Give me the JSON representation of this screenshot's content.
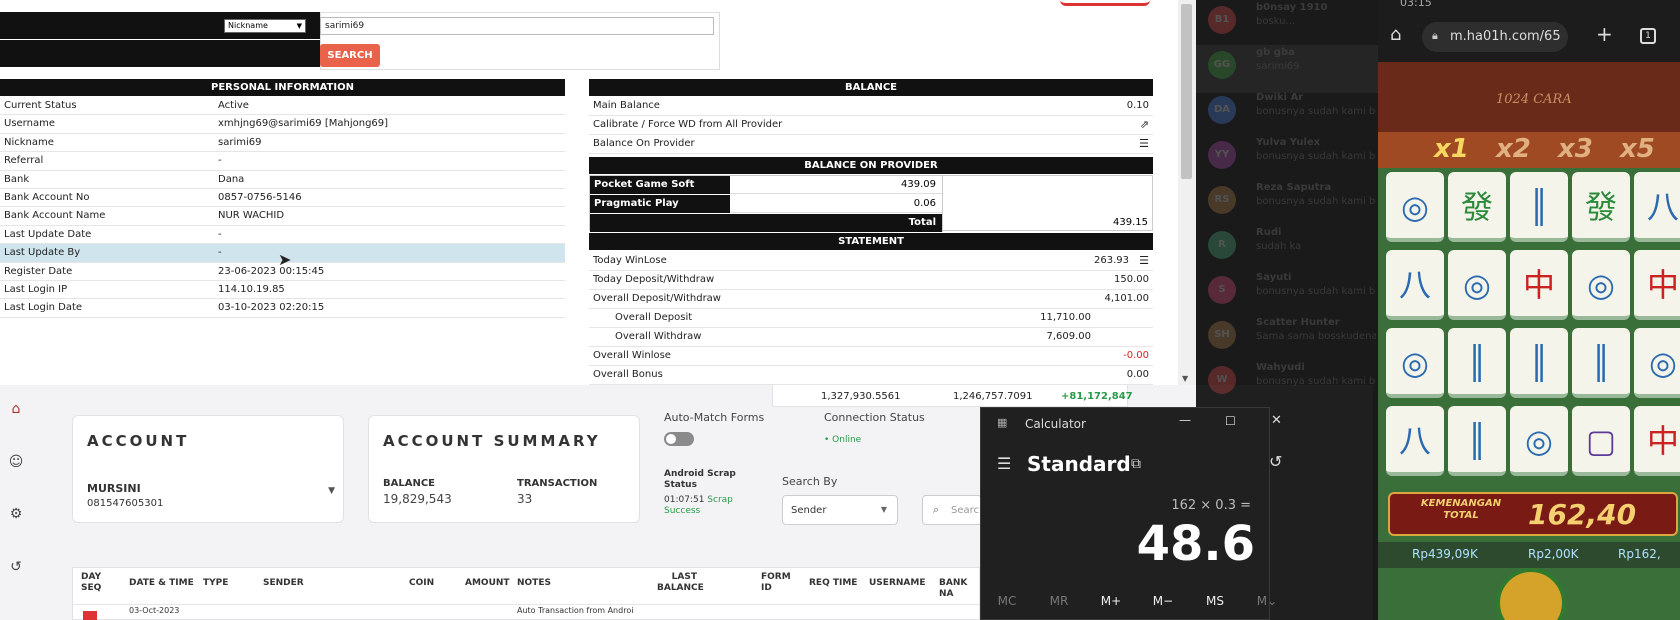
{
  "admin": {
    "search": {
      "dropdown_value": "Nickname",
      "input_value": "sarimi69",
      "button_label": "SEARCH"
    },
    "personal": {
      "heading": "PERSONAL INFORMATION",
      "rows": [
        {
          "k": "Current Status",
          "v": "Active"
        },
        {
          "k": "Username",
          "v": "xmhjng69@sarimi69  [Mahjong69]"
        },
        {
          "k": "Nickname",
          "v": "sarimi69"
        },
        {
          "k": "Referral",
          "v": "-"
        },
        {
          "k": "Bank",
          "v": "Dana"
        },
        {
          "k": "Bank Account No",
          "v": "0857-0756-5146"
        },
        {
          "k": "Bank Account Name",
          "v": "NUR WACHID"
        },
        {
          "k": "Last Update Date",
          "v": "-"
        },
        {
          "k": "Last Update By",
          "v": "-"
        },
        {
          "k": "Register Date",
          "v": "23-06-2023 00:15:45"
        },
        {
          "k": "Last Login IP",
          "v": "114.10.19.85"
        },
        {
          "k": "Last Login Date",
          "v": "03-10-2023 02:20:15"
        }
      ]
    },
    "balance": {
      "heading": "BALANCE",
      "main_balance_label": "Main Balance",
      "main_balance": "0.10",
      "calibrate_label": "Calibrate / Force WD from All Provider",
      "on_provider_label": "Balance On Provider",
      "provider_heading": "BALANCE ON PROVIDER",
      "providers": [
        {
          "name": "Pocket Game Soft",
          "value": "439.09"
        },
        {
          "name": "Pragmatic Play",
          "value": "0.06"
        }
      ],
      "total_label": "Total",
      "total_value": "439.15"
    },
    "statement": {
      "heading": "STATEMENT",
      "today_winlose_label": "Today WinLose",
      "today_winlose": "263.93",
      "today_dw_label": "Today Deposit/Withdraw",
      "today_dw": "150.00",
      "overall_dw_label": "Overall Deposit/Withdraw",
      "overall_dw": "4,101.00",
      "overall_deposit_label": "Overall Deposit",
      "overall_deposit": "11,710.00",
      "overall_withdraw_label": "Overall Withdraw",
      "overall_withdraw": "7,609.00",
      "overall_winlose_label": "Overall Winlose",
      "overall_winlose": "-0.00",
      "overall_bonus_label": "Overall Bonus",
      "overall_bonus": "0.00"
    }
  },
  "dash": {
    "top_values": {
      "a": "1,327,930.5561",
      "b": "1,246,757.7091",
      "c": "+81,172,847"
    },
    "account": {
      "title": "ACCOUNT",
      "name": "MURSINI",
      "phone": "081547605301"
    },
    "summary": {
      "title": "ACCOUNT SUMMARY",
      "balance_label": "BALANCE",
      "balance": "19,829,543",
      "transaction_label": "TRANSACTION",
      "transaction": "33"
    },
    "auto_match_label": "Auto-Match Forms",
    "connection_label": "Connection Status",
    "connection_value": "• Online",
    "scrap_label": "Android Scrap Status",
    "scrap_time": "01:07:51",
    "scrap_value": "Scrap Success",
    "search_by_label": "Search By",
    "search_by_value": "Sender",
    "search_placeholder": "Searc",
    "table_headers": [
      "DAY SEQ",
      "DATE & TIME",
      "TYPE",
      "SENDER",
      "COIN",
      "AMOUNT",
      "NOTES",
      "LAST BALANCE",
      "FORM ID",
      "REQ TIME",
      "USERNAME",
      "BANK NA"
    ],
    "first_row": {
      "date": "03-Oct-2023",
      "notes": "Auto Transaction from Androi"
    }
  },
  "calculator": {
    "title": "Calculator",
    "mode": "Standard",
    "expression": "162 × 0.3 =",
    "result": "48.6",
    "memory_buttons": [
      "MC",
      "MR",
      "M+",
      "M−",
      "MS",
      "M⌄"
    ]
  },
  "chat": {
    "items": [
      {
        "initials": "B1",
        "name": "b0nsay 1910",
        "msg": "bosku...",
        "color": "#5a2a2a"
      },
      {
        "initials": "GG",
        "name": "gb gba",
        "msg": "sarimi69",
        "color": "#2a4a2a"
      },
      {
        "initials": "DA",
        "name": "Dwiki Ar",
        "msg": "bonusnya sudah kami be",
        "color": "#2a3a5a"
      },
      {
        "initials": "YY",
        "name": "Yulva Yulex",
        "msg": "bonusnya sudah kami be",
        "color": "#4a2a4a"
      },
      {
        "initials": "RS",
        "name": "Reza Saputra",
        "msg": "bonusnya sudah kami be",
        "color": "#4a3a2a"
      },
      {
        "initials": "R",
        "name": "Rudi",
        "msg": "sudah ka",
        "color": "#2a4a3a"
      },
      {
        "initials": "S",
        "name": "Sayuti",
        "msg": "bonusnya sudah kami be",
        "color": "#5a2a3a"
      },
      {
        "initials": "SH",
        "name": "Scatter Hunter",
        "msg": "Sama sama bosskudenal",
        "color": "#4a3a2a"
      },
      {
        "initials": "W",
        "name": "Wahyudi",
        "msg": "bonusnya sudah kami be",
        "color": "#5a2a2a"
      }
    ]
  },
  "phone": {
    "time": "03:15",
    "url": "m.ha01h.com/65",
    "game_label": "1024 CARA",
    "multipliers": [
      "x1",
      "x2",
      "x3",
      "x5"
    ],
    "win_label": "KEMENANGAN TOTAL",
    "win_value": "162,40",
    "balance_strip": [
      "Rp439,09K",
      "Rp2,00K",
      "Rp162,"
    ]
  }
}
